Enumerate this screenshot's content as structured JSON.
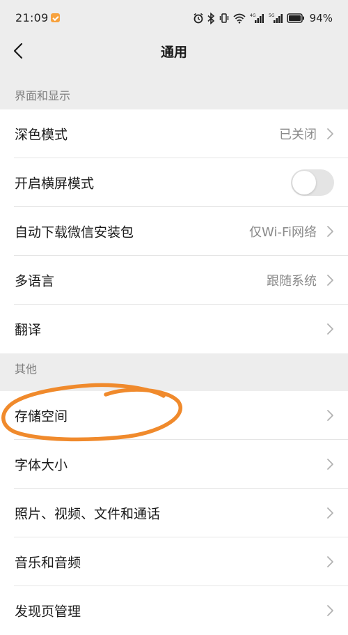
{
  "status_bar": {
    "time": "21:09",
    "battery_percent": "94%",
    "signal_1_label": "4G",
    "signal_2_label": "5G"
  },
  "nav": {
    "title": "通用",
    "back_icon": "chevron-left-icon"
  },
  "sections": [
    {
      "header": "界面和显示",
      "rows": [
        {
          "label": "深色模式",
          "value": "已关闭",
          "type": "chevron"
        },
        {
          "label": "开启横屏模式",
          "value": "",
          "type": "toggle",
          "toggle_on": false
        },
        {
          "label": "自动下载微信安装包",
          "value": "仅Wi-Fi网络",
          "type": "chevron"
        },
        {
          "label": "多语言",
          "value": "跟随系统",
          "type": "chevron"
        },
        {
          "label": "翻译",
          "value": "",
          "type": "chevron"
        }
      ]
    },
    {
      "header": "其他",
      "rows": [
        {
          "label": "存储空间",
          "value": "",
          "type": "chevron"
        },
        {
          "label": "字体大小",
          "value": "",
          "type": "chevron"
        },
        {
          "label": "照片、视频、文件和通话",
          "value": "",
          "type": "chevron"
        },
        {
          "label": "音乐和音频",
          "value": "",
          "type": "chevron"
        },
        {
          "label": "发现页管理",
          "value": "",
          "type": "chevron"
        }
      ]
    }
  ],
  "annotation": {
    "shape": "hand-drawn-circle",
    "color": "#f08a2c",
    "target": "存储空间"
  },
  "colors": {
    "page_background": "#ededed",
    "row_background": "#ffffff",
    "section_header_text": "#7d7d7d",
    "secondary_text": "#8a8a8a",
    "toggle_off": "#e4e4e4"
  }
}
